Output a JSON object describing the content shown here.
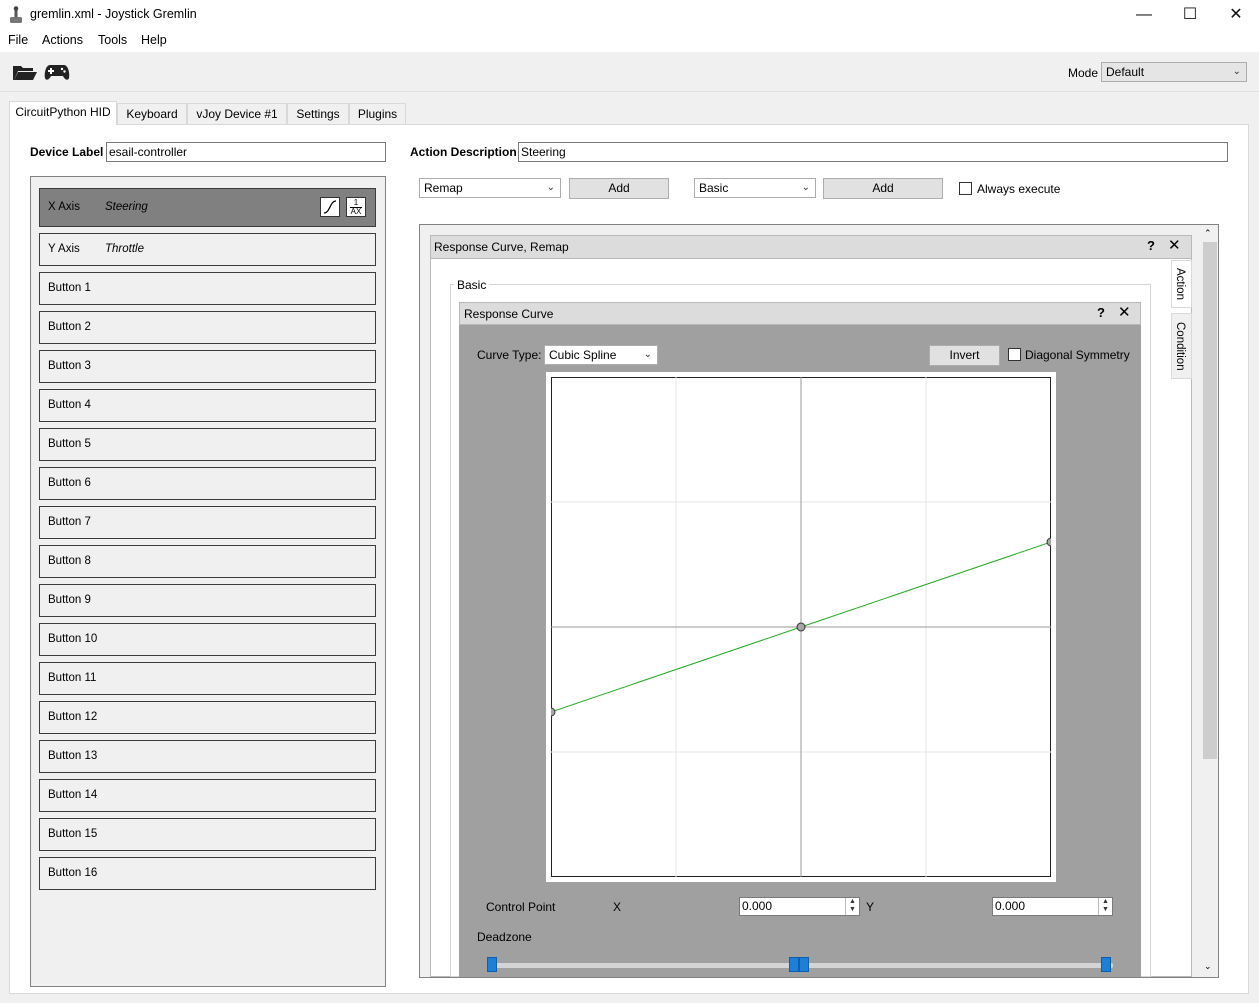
{
  "window": {
    "title": "gremlin.xml - Joystick Gremlin",
    "minimize": "—",
    "maximize": "☐",
    "close": "✕"
  },
  "menu": [
    "File",
    "Actions",
    "Tools",
    "Help"
  ],
  "toolbar": {
    "mode_label": "Mode",
    "mode_value": "Default"
  },
  "tabs": [
    "CircuitPython HID",
    "Keyboard",
    "vJoy Device #1",
    "Settings",
    "Plugins"
  ],
  "device": {
    "label_caption": "Device Label",
    "label_value": "esail-controller"
  },
  "action": {
    "description_caption": "Action Description",
    "description_value": "Steering",
    "action_combo": "Remap",
    "add_label": "Add",
    "condition_combo": "Basic",
    "add2_label": "Add",
    "always_execute": "Always execute"
  },
  "inputs": [
    {
      "name": "X Axis",
      "desc": "Steering"
    },
    {
      "name": "Y Axis",
      "desc": "Throttle"
    },
    {
      "name": "Button 1",
      "desc": ""
    },
    {
      "name": "Button 2",
      "desc": ""
    },
    {
      "name": "Button 3",
      "desc": ""
    },
    {
      "name": "Button 4",
      "desc": ""
    },
    {
      "name": "Button 5",
      "desc": ""
    },
    {
      "name": "Button 6",
      "desc": ""
    },
    {
      "name": "Button 7",
      "desc": ""
    },
    {
      "name": "Button 8",
      "desc": ""
    },
    {
      "name": "Button 9",
      "desc": ""
    },
    {
      "name": "Button 10",
      "desc": ""
    },
    {
      "name": "Button 11",
      "desc": ""
    },
    {
      "name": "Button 12",
      "desc": ""
    },
    {
      "name": "Button 13",
      "desc": ""
    },
    {
      "name": "Button 14",
      "desc": ""
    },
    {
      "name": "Button 15",
      "desc": ""
    },
    {
      "name": "Button 16",
      "desc": ""
    }
  ],
  "axis_icon_text": {
    "top": "1",
    "bottom": "AX"
  },
  "container": {
    "title": "Response Curve, Remap",
    "help": "?",
    "close": "✕",
    "group_label": "Basic",
    "side_tabs": [
      "Action",
      "Condition"
    ]
  },
  "curve": {
    "title": "Response Curve",
    "help": "?",
    "close": "✕",
    "curve_type_label": "Curve Type:",
    "curve_type_value": "Cubic Spline",
    "invert_label": "Invert",
    "diagonal_symmetry_label": "Diagonal Symmetry",
    "control_points": [
      [
        -1.0,
        -0.34
      ],
      [
        0.0,
        0.0
      ],
      [
        1.0,
        0.34
      ]
    ],
    "line_color": "#22aa22",
    "control_point_label": "Control Point",
    "x_label": "X",
    "x_value": "0.000",
    "y_label": "Y",
    "y_value": "0.000",
    "deadzone_label": "Deadzone",
    "deadzone": [
      -1.0,
      0.0,
      0.0,
      1.0
    ],
    "handle_color": "#1e7fd6"
  }
}
